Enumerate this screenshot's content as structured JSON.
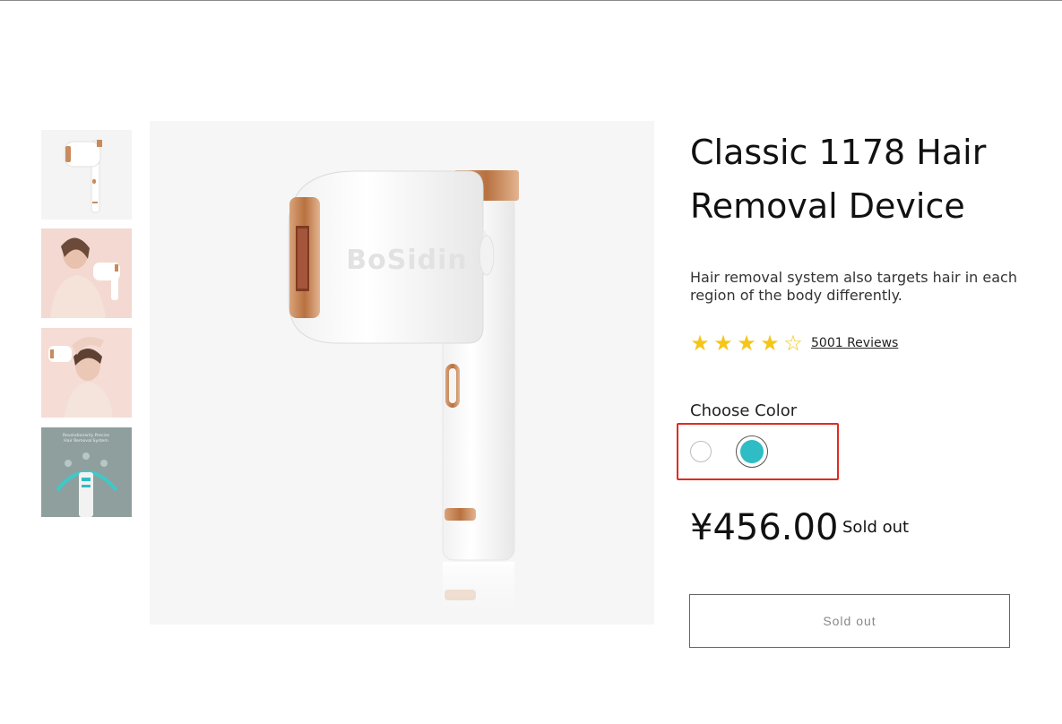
{
  "gallery": {
    "thumbnails": [
      {
        "alt": "device-front",
        "active": true
      },
      {
        "alt": "model-with-device-1",
        "active": false
      },
      {
        "alt": "model-with-device-2",
        "active": false
      },
      {
        "alt": "product-infographic",
        "active": false
      }
    ],
    "thumbnail_4_caption_line1": "Revolutionarily Precise",
    "thumbnail_4_caption_line2": "Hair Removal System",
    "brand_on_device": "BoSidin"
  },
  "product": {
    "title": "Classic 1178 Hair Removal Device",
    "description": "Hair removal system also targets hair in each region of the body differently.",
    "rating": {
      "stars_filled": 4,
      "stars_total": 5,
      "reviews_label": "5001 Reviews"
    },
    "color_picker": {
      "label": "Choose Color",
      "options": [
        {
          "name": "white",
          "hex": "#ffffff",
          "selected": false
        },
        {
          "name": "teal",
          "hex": "#2fbcc4",
          "selected": true
        }
      ]
    },
    "price": "¥456.00",
    "availability": "Sold out",
    "buy_button_label": "Sold out"
  },
  "colors": {
    "highlight": "#e02b20",
    "star": "#f5c518",
    "accent_copper": "#c98a5c"
  }
}
